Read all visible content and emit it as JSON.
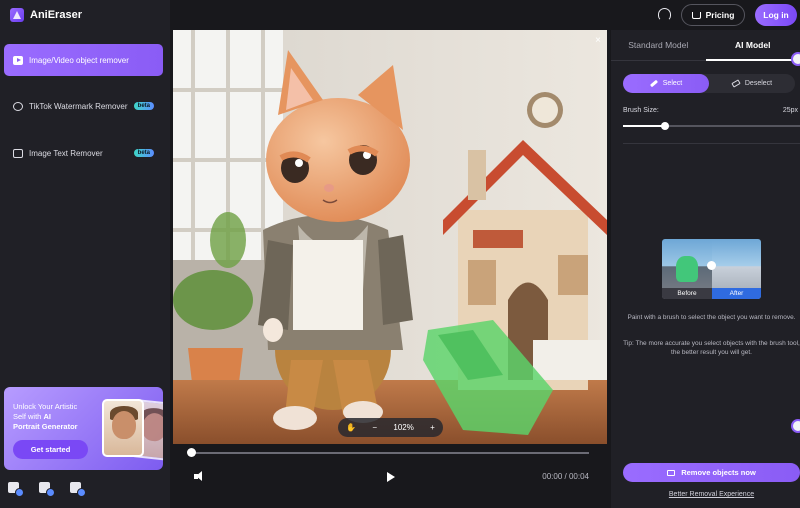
{
  "app": {
    "name": "AniEraser"
  },
  "sidebar": {
    "items": [
      {
        "label": "Image/Video object remover",
        "badge": "",
        "active": true
      },
      {
        "label": "TikTok Watermark Remover",
        "badge": "beta",
        "active": false
      },
      {
        "label": "Image Text Remover",
        "badge": "beta",
        "active": false
      }
    ],
    "promo": {
      "line1": "Unlock Your Artistic",
      "line2_prefix": "Self with",
      "line2_bold": "AI",
      "line3": "Portrait Generator",
      "button": "Get started"
    },
    "platform_icons": [
      "windows-icon",
      "mac-icon",
      "ios-icon"
    ]
  },
  "header": {
    "support_icon": "headset-icon",
    "pricing_label": "Pricing",
    "login_label": "Log in"
  },
  "canvas": {
    "close_glyph": "×",
    "zoom_level": "102%",
    "zoom_out": "−",
    "zoom_in": "+"
  },
  "player": {
    "time": "00:00 / 00:04",
    "progress": 0
  },
  "panel": {
    "tabs": [
      {
        "label": "Standard Model",
        "active": false
      },
      {
        "label": "AI Model",
        "active": true
      }
    ],
    "select_label": "Select",
    "deselect_label": "Deselect",
    "brush_label": "Brush Size:",
    "brush_value": "25px",
    "brush_fraction": 0.24,
    "before_label": "Before",
    "after_label": "After",
    "hint": "Paint with a brush to select the object you want to remove.",
    "tip": "Tip: The more accurate you select objects with the brush tool, the better result you will get.",
    "remove_label": "Remove objects now",
    "better_link": "Better Removal Experience"
  },
  "colors": {
    "accent": "#8a5cf5",
    "background": "#18181c",
    "panel": "#202026",
    "selection_green": "#5bd46a"
  }
}
